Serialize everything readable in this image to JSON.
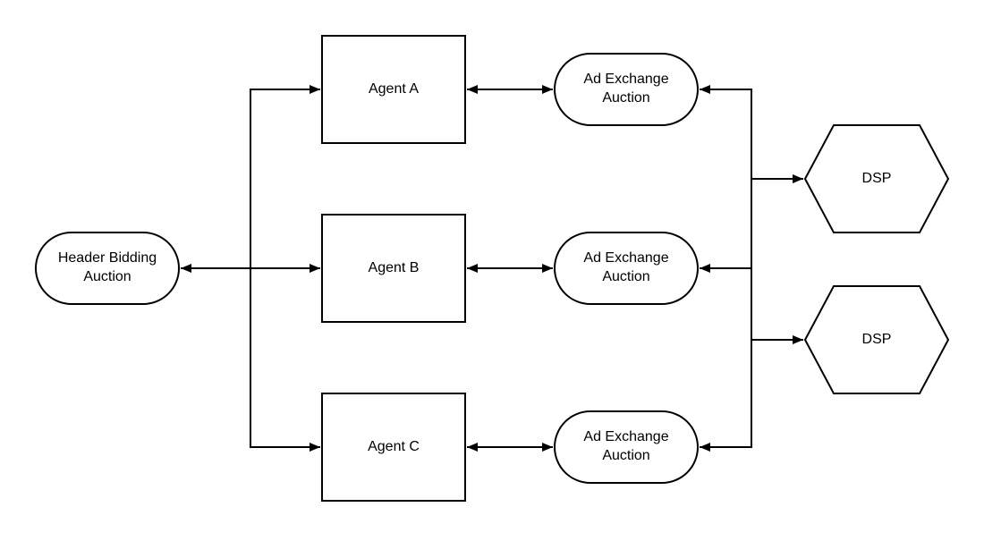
{
  "header_bidding": {
    "line1": "Header Bidding",
    "line2": "Auction"
  },
  "agents": [
    {
      "label": "Agent A"
    },
    {
      "label": "Agent B"
    },
    {
      "label": "Agent C"
    }
  ],
  "ad_exchanges": [
    {
      "line1": "Ad Exchange",
      "line2": "Auction"
    },
    {
      "line1": "Ad Exchange",
      "line2": "Auction"
    },
    {
      "line1": "Ad Exchange",
      "line2": "Auction"
    }
  ],
  "dsps": [
    {
      "label": "DSP"
    },
    {
      "label": "DSP"
    }
  ],
  "colors": {
    "stroke": "#000000",
    "fill": "#ffffff"
  }
}
